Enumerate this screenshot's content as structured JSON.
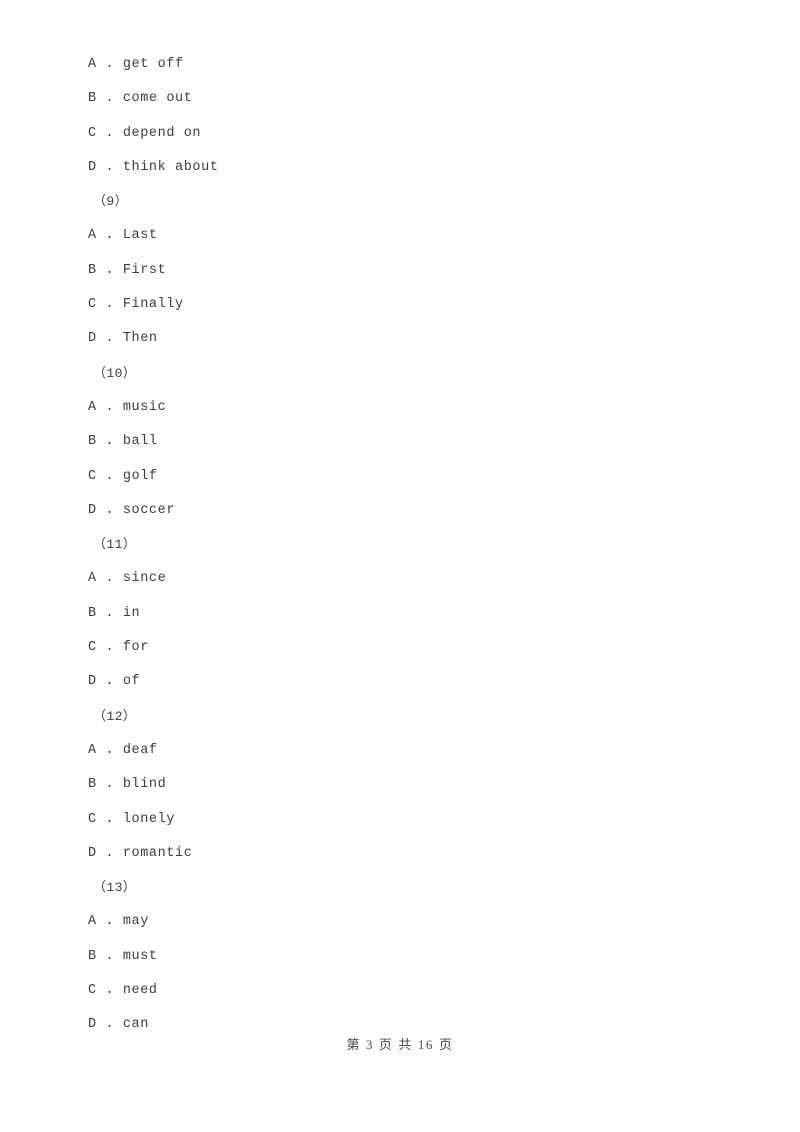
{
  "document": {
    "page_label": "第 3 页 共 16 页",
    "text_color": "#3d3d3d",
    "background_color": "#ffffff"
  },
  "blocks": [
    {
      "question_number": null,
      "options": [
        {
          "letter": "A",
          "separator": " . ",
          "text": "get off"
        },
        {
          "letter": "B",
          "separator": " . ",
          "text": "come out"
        },
        {
          "letter": "C",
          "separator": " . ",
          "text": "depend on"
        },
        {
          "letter": "D",
          "separator": " . ",
          "text": "think about"
        }
      ]
    },
    {
      "question_number": "（9）",
      "options": [
        {
          "letter": "A",
          "separator": " . ",
          "text": "Last"
        },
        {
          "letter": "B",
          "separator": " . ",
          "text": "First"
        },
        {
          "letter": "C",
          "separator": " . ",
          "text": "Finally"
        },
        {
          "letter": "D",
          "separator": " . ",
          "text": "Then"
        }
      ]
    },
    {
      "question_number": "（10）",
      "options": [
        {
          "letter": "A",
          "separator": " . ",
          "text": "music"
        },
        {
          "letter": "B",
          "separator": " . ",
          "text": "ball"
        },
        {
          "letter": "C",
          "separator": " . ",
          "text": "golf"
        },
        {
          "letter": "D",
          "separator": " . ",
          "text": "soccer"
        }
      ]
    },
    {
      "question_number": "（11）",
      "options": [
        {
          "letter": "A",
          "separator": " . ",
          "text": "since"
        },
        {
          "letter": "B",
          "separator": " . ",
          "text": "in"
        },
        {
          "letter": "C",
          "separator": " . ",
          "text": "for"
        },
        {
          "letter": "D",
          "separator": " . ",
          "text": "of"
        }
      ]
    },
    {
      "question_number": "（12）",
      "options": [
        {
          "letter": "A",
          "separator": " . ",
          "text": "deaf"
        },
        {
          "letter": "B",
          "separator": " . ",
          "text": "blind"
        },
        {
          "letter": "C",
          "separator": " . ",
          "text": "lonely"
        },
        {
          "letter": "D",
          "separator": " . ",
          "text": "romantic"
        }
      ]
    },
    {
      "question_number": "（13）",
      "options": [
        {
          "letter": "A",
          "separator": " . ",
          "text": "may"
        },
        {
          "letter": "B",
          "separator": " . ",
          "text": "must"
        },
        {
          "letter": "C",
          "separator": " . ",
          "text": "need"
        },
        {
          "letter": "D",
          "separator": " . ",
          "text": "can"
        }
      ]
    }
  ]
}
